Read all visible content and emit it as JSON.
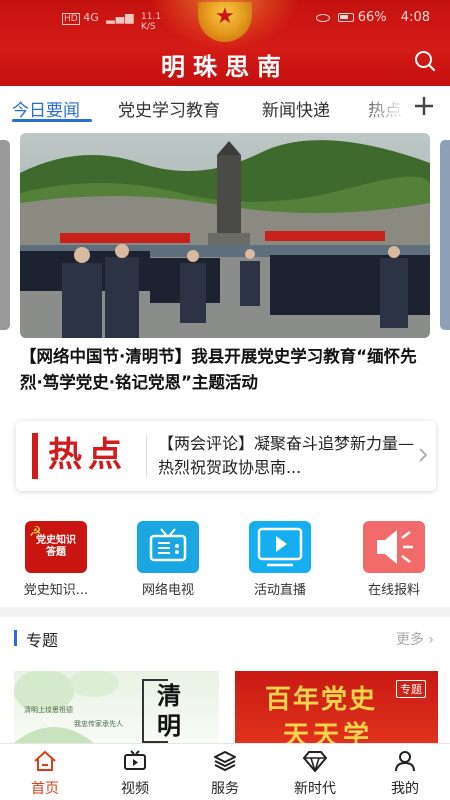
{
  "status_bar": {
    "network": "4G",
    "speed": "11.1",
    "speed_unit": "K/S",
    "battery": "66%",
    "time": "4:08"
  },
  "app": {
    "title": "明珠思南"
  },
  "tabs": [
    {
      "label": "今日要闻",
      "active": true
    },
    {
      "label": "党史学习教育"
    },
    {
      "label": "新闻快递"
    },
    {
      "label": "热点"
    }
  ],
  "feature": {
    "headline": "【网络中国节·清明节】我县开展党史学习教育“缅怀先烈·笃学党史·铭记党恩”主题活动"
  },
  "hot": {
    "logo_text": "热点",
    "news": "【两会评论】凝聚奋斗追梦新力量—热烈祝贺政协思南..."
  },
  "quick_links": [
    {
      "label": "党史知识...",
      "icon": "party-history-quiz-icon",
      "icon_text_line1": "党史知识",
      "icon_text_line2": "答题"
    },
    {
      "label": "网络电视",
      "icon": "tv-icon"
    },
    {
      "label": "活动直播",
      "icon": "live-play-icon"
    },
    {
      "label": "在线报料",
      "icon": "megaphone-icon"
    }
  ],
  "special": {
    "title": "专题",
    "more": "更多",
    "cards": [
      {
        "title": "清明",
        "poem_line1": "清明上坟思祖德",
        "poem_line2": "我忠传家承先人"
      },
      {
        "title": "百年党史",
        "subtitle": "天天学",
        "badge": "专题"
      }
    ]
  },
  "bottom_nav": [
    {
      "label": "首页",
      "icon": "home-icon",
      "active": true
    },
    {
      "label": "视频",
      "icon": "video-icon"
    },
    {
      "label": "服务",
      "icon": "layers-icon"
    },
    {
      "label": "新时代",
      "icon": "diamond-icon"
    },
    {
      "label": "我的",
      "icon": "user-icon"
    }
  ],
  "colors": {
    "header_red": "#c5120f",
    "accent_blue": "#2a6fd6",
    "hot_red": "#d21c1c",
    "nav_active": "#d5401b"
  }
}
